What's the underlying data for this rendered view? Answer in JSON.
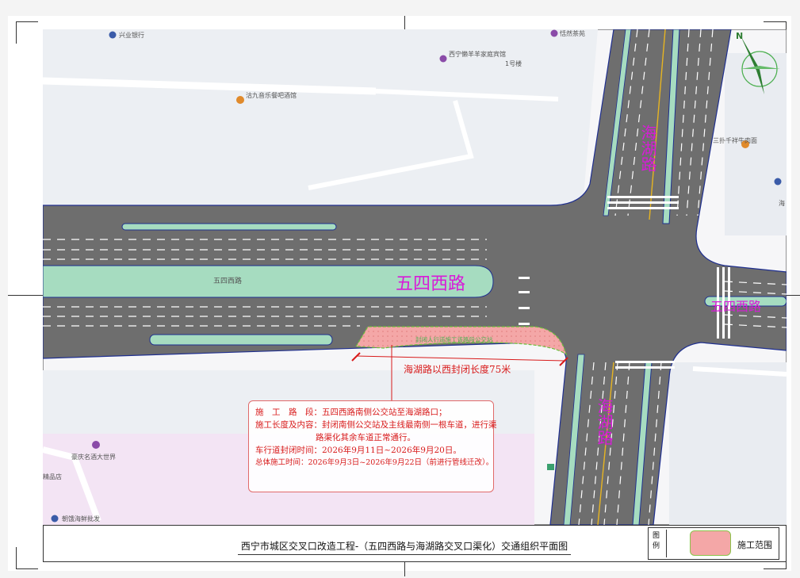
{
  "drawing": {
    "title": "西宁市城区交叉口改造工程-（五四西路与海湖路交叉口渠化）交通组织平面图",
    "legend_label": "图例",
    "legend_item": "施工范围"
  },
  "roads": {
    "main_road_large": "五四西路",
    "main_road_small": "五四西路",
    "main_road_east": "五四西路",
    "cross_road_north": "海湖路",
    "cross_road_south": "海湖路",
    "closure_tag": "封闭人行道施工该路段公交站",
    "closure_length": "海湖路以西封闭长度75米"
  },
  "pois": [
    {
      "name": "兴业银行"
    },
    {
      "name": "恬然茶苑"
    },
    {
      "name": "西宁懒羊羊家庭宾馆"
    },
    {
      "name": "1号楼"
    },
    {
      "name": "沽九音乐餐吧酒馆"
    },
    {
      "name": "三扑千祥牛肉面"
    },
    {
      "name": "海"
    },
    {
      "name": "豪庆名酒大世界"
    },
    {
      "name": "精品店"
    },
    {
      "name": "朝饿海鲜批发"
    }
  ],
  "note": {
    "line1": "施　工　路　段：五四西路南侧公交站至海湖路口；",
    "line2": "施工长度及内容：封闭南侧公交站及主线最南侧一根车道，进行渠",
    "line3": "路渠化其余车道正常通行。",
    "line4": "车行道封闭时间：2026年9月11日~2026年9月20日。",
    "line5": "总体施工时间：2026年9月3日~2026年9月22日（前进行管线迁改）。"
  },
  "colors": {
    "road": "#6e6e6e",
    "median": "#a6dcc0",
    "closure": "#f4a7a7",
    "road_label": "#d81bd8",
    "note": "#d81b1b"
  },
  "icons": [
    "compass-icon",
    "poi-pin-icon",
    "bus-stop-icon"
  ]
}
